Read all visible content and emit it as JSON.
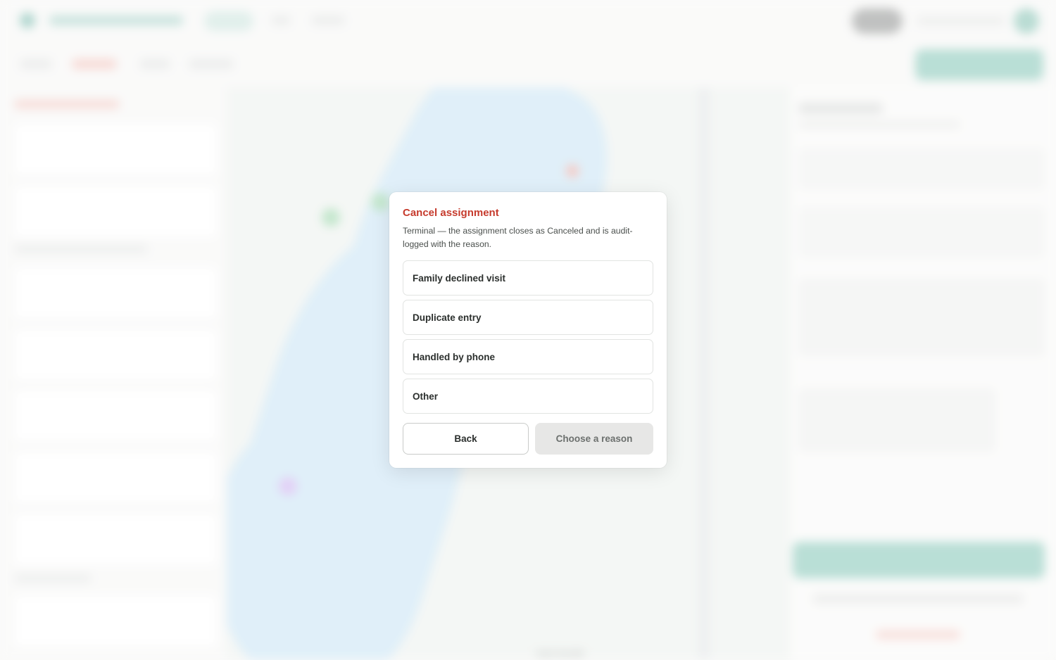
{
  "modal": {
    "title": "Cancel assignment",
    "description": "Terminal — the assignment closes as Canceled and is audit-logged with the reason.",
    "reasons": [
      {
        "label": "Family declined visit"
      },
      {
        "label": "Duplicate entry"
      },
      {
        "label": "Handled by phone"
      },
      {
        "label": "Other"
      }
    ],
    "back_label": "Back",
    "confirm_label": "Choose a reason",
    "confirm_disabled": true
  },
  "background": {
    "map_caption": "Hazel Granville"
  },
  "colors": {
    "title_red": "#c63b2d",
    "brand_teal": "#7dbcb0",
    "water": "#cde6f5",
    "disabled_button": "#e7e7e6"
  }
}
